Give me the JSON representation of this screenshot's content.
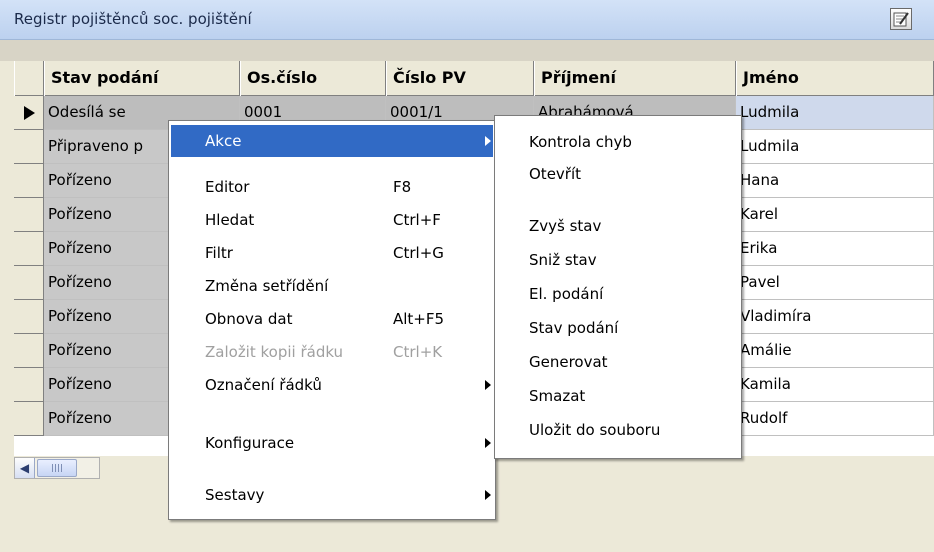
{
  "window": {
    "title": "Registr pojištěnců soc. pojištění",
    "title_button_icon": "edit-note-icon"
  },
  "grid": {
    "columns": [
      "Stav podání",
      "Os.číslo",
      "Číslo PV",
      "Příjmení",
      "Jméno"
    ],
    "rows": [
      {
        "stav": "Odesílá se",
        "os": "0001",
        "pv": "0001/1",
        "prijmeni": "Abrahámová",
        "jmeno": "Ludmila"
      },
      {
        "stav": "Připraveno p",
        "os": "",
        "pv": "",
        "prijmeni": "",
        "jmeno": "Ludmila"
      },
      {
        "stav": "Pořízeno",
        "os": "",
        "pv": "",
        "prijmeni": "",
        "jmeno": "Hana"
      },
      {
        "stav": "Pořízeno",
        "os": "",
        "pv": "",
        "prijmeni": "",
        "jmeno": "Karel"
      },
      {
        "stav": "Pořízeno",
        "os": "",
        "pv": "",
        "prijmeni": "",
        "jmeno": "Erika"
      },
      {
        "stav": "Pořízeno",
        "os": "",
        "pv": "",
        "prijmeni": "",
        "jmeno": "Pavel"
      },
      {
        "stav": "Pořízeno",
        "os": "",
        "pv": "",
        "prijmeni": "",
        "jmeno": "Vladimíra"
      },
      {
        "stav": "Pořízeno",
        "os": "",
        "pv": "",
        "prijmeni": "",
        "jmeno": "Amálie"
      },
      {
        "stav": "Pořízeno",
        "os": "",
        "pv": "",
        "prijmeni": "",
        "jmeno": "Kamila"
      },
      {
        "stav": "Pořízeno",
        "os": "",
        "pv": "",
        "prijmeni": "",
        "jmeno": "Rudolf"
      }
    ]
  },
  "context_menu": {
    "items": [
      {
        "label": "Akce",
        "shortcut": "",
        "submenu": true,
        "highlighted": true
      },
      {
        "label": "Editor",
        "shortcut": "F8"
      },
      {
        "label": "Hledat",
        "shortcut": "Ctrl+F"
      },
      {
        "label": "Filtr",
        "shortcut": "Ctrl+G"
      },
      {
        "label": "Změna setřídění",
        "shortcut": ""
      },
      {
        "label": "Obnova dat",
        "shortcut": "Alt+F5"
      },
      {
        "label": "Založit kopii řádku",
        "shortcut": "Ctrl+K",
        "disabled": true
      },
      {
        "label": "Označení řádků",
        "shortcut": "",
        "submenu": true
      },
      {
        "label": "Konfigurace",
        "shortcut": "",
        "submenu": true
      },
      {
        "label": "Sestavy",
        "shortcut": "",
        "submenu": true
      }
    ]
  },
  "submenu_akce": {
    "items": [
      "Kontrola chyb",
      "Otevřít",
      "Zvyš stav",
      "Sniž stav",
      "El. podání",
      "Stav podání",
      "Generovat",
      "Smazat",
      "Uložit do souboru"
    ]
  },
  "colors": {
    "highlight": "#316ac5",
    "title_bar": "#c7d9f1",
    "selected_row": "#cfd9ec"
  }
}
